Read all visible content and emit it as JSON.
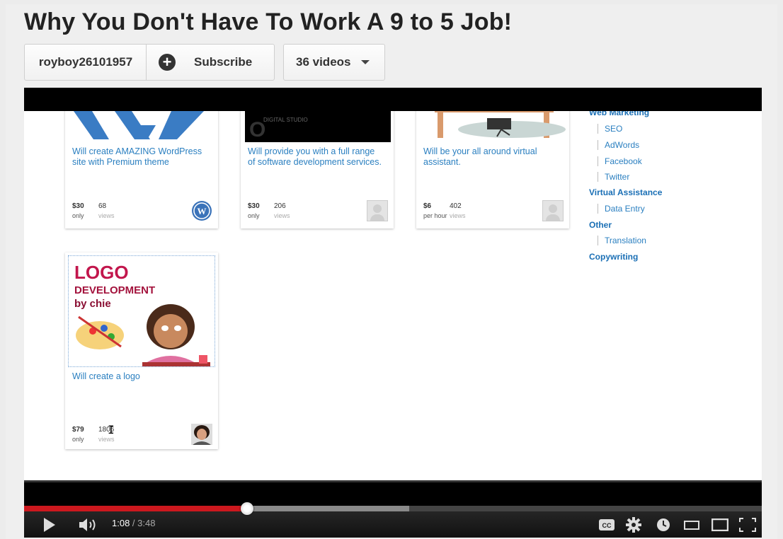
{
  "page": {
    "title": "Why You Don't Have To Work A 9 to 5 Job!"
  },
  "header": {
    "channel_name": "royboy26101957",
    "subscribe_label": "Subscribe",
    "videos_label": "36 videos"
  },
  "video_content": {
    "cards": [
      {
        "description": "Will create AMAZING WordPress site with Premium theme",
        "price": "$30",
        "price_unit": "only",
        "views": "68",
        "views_label": "views"
      },
      {
        "description": "Will provide you with a full range of software development services.",
        "price": "$30",
        "price_unit": "only",
        "views": "206",
        "views_label": "views",
        "thumb_text": "DIGITAL STUDIO"
      },
      {
        "description": "Will be your all around virtual assistant.",
        "price": "$6",
        "price_unit": "per hour",
        "views": "402",
        "views_label": "views"
      },
      {
        "description": "Will create a logo",
        "price": "$79",
        "price_unit": "only",
        "views": "1806",
        "views_label": "views",
        "logo_line1": "LOGO",
        "logo_line2": "DEVELOPMENT",
        "logo_line3": "by chie"
      }
    ],
    "categories": {
      "web_marketing": "Web Marketing",
      "seo": "SEO",
      "adwords": "AdWords",
      "facebook": "Facebook",
      "twitter": "Twitter",
      "virtual_assistance": "Virtual Assistance",
      "data_entry": "Data Entry",
      "other": "Other",
      "translation": "Translation",
      "copywriting": "Copywriting"
    }
  },
  "player": {
    "current_time": "1:08",
    "separator": " / ",
    "duration": "3:48",
    "played_fraction": 0.3,
    "loaded_fraction": 0.522,
    "icons": {
      "play": "play-icon",
      "volume": "volume-icon",
      "cc": "captions-icon",
      "settings": "gear-icon",
      "watch_later": "clock-icon",
      "small_player": "small-player-icon",
      "large_player": "large-player-icon",
      "fullscreen": "fullscreen-icon"
    },
    "colors": {
      "played": "#cc181e",
      "loaded": "#8a8a8a"
    }
  }
}
